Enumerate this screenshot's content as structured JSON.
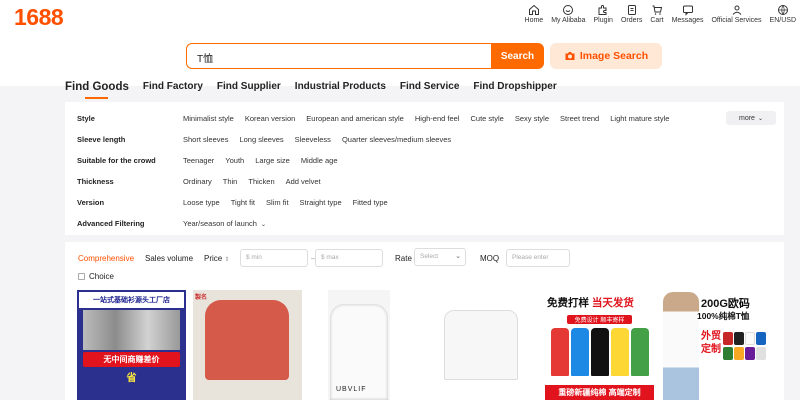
{
  "header": {
    "logo": "1688",
    "nav": [
      {
        "label": "Home",
        "icon": "home-icon"
      },
      {
        "label": "My Alibaba",
        "icon": "user-smile-icon"
      },
      {
        "label": "Plugin",
        "icon": "puzzle-icon"
      },
      {
        "label": "Orders",
        "icon": "orders-icon"
      },
      {
        "label": "Cart",
        "icon": "cart-icon"
      },
      {
        "label": "Messages",
        "icon": "message-icon"
      },
      {
        "label": "Official Services",
        "icon": "person-icon"
      },
      {
        "label": "EN/USD",
        "icon": "globe-icon"
      }
    ]
  },
  "search": {
    "value": "T恤",
    "button": "Search",
    "image_search": "Image Search"
  },
  "tabs": [
    "Find Goods",
    "Find Factory",
    "Find Supplier",
    "Industrial Products",
    "Find Service",
    "Find Dropshipper"
  ],
  "filters": {
    "more": "more",
    "rows": [
      {
        "label": "Style",
        "options": [
          "Minimalist style",
          "Korean version",
          "European and american style",
          "High-end feel",
          "Cute style",
          "Sexy style",
          "Street trend",
          "Light mature style"
        ]
      },
      {
        "label": "Sleeve length",
        "options": [
          "Short sleeves",
          "Long sleeves",
          "Sleeveless",
          "Quarter sleeves/medium sleeves"
        ]
      },
      {
        "label": "Suitable for the crowd",
        "options": [
          "Teenager",
          "Youth",
          "Large size",
          "Middle age"
        ]
      },
      {
        "label": "Thickness",
        "options": [
          "Ordinary",
          "Thin",
          "Thicken",
          "Add velvet"
        ]
      },
      {
        "label": "Version",
        "options": [
          "Loose type",
          "Tight fit",
          "Slim fit",
          "Straight type",
          "Fitted type"
        ]
      },
      {
        "label": "Advanced Filtering",
        "options": [
          "Year/season of launch"
        ]
      }
    ]
  },
  "sort": {
    "comprehensive": "Comprehensive",
    "sales_volume": "Sales volume",
    "price": "Price",
    "price_min": "$ min",
    "price_max": "$ max",
    "rate": "Rate",
    "rate_select": "Select",
    "moq": "MOQ",
    "moq_placeholder": "Please enter",
    "choice": "Choice"
  },
  "products": {
    "p1": {
      "banner": "一站式基础衫源头工厂店",
      "red": "无中间商赚差价",
      "mid": "省"
    },
    "p2": {
      "brand": "製名"
    },
    "p3": {
      "text": "UBVLIF"
    },
    "p5": {
      "title_a": "免费打样",
      "title_b": "当天发货",
      "sub": "免费设计 顺丰寄样",
      "foot": "重磅新疆纯棉 高端定制"
    },
    "p6": {
      "t1": "200G欧码",
      "t2": "100%纯棉T恤",
      "red": "外贸定制"
    }
  },
  "colors": {
    "accent": "#ff6a00",
    "brand": "#ff5000"
  }
}
